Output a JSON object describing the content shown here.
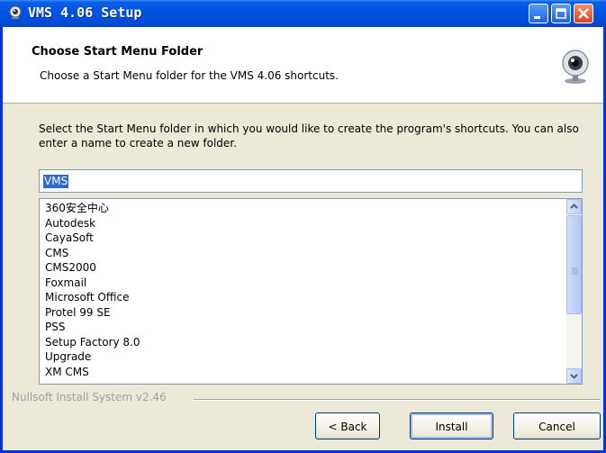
{
  "window": {
    "title": "VMS 4.06 Setup",
    "accent": "#0054e3"
  },
  "header": {
    "title": "Choose Start Menu Folder",
    "subtitle": "Choose a Start Menu folder for the VMS 4.06 shortcuts.",
    "icon": "webcam-icon"
  },
  "body": {
    "instructions": "Select the Start Menu folder in which you would like to create the program's shortcuts. You can also enter a name to create a new folder.",
    "folder_value": "VMS",
    "folders": [
      "360安全中心",
      "Autodesk",
      "CayaSoft",
      "CMS",
      "CMS2000",
      "Foxmail",
      "Microsoft Office",
      "Protel 99 SE",
      "PSS",
      "Setup Factory 8.0",
      "Upgrade",
      "XM CMS"
    ]
  },
  "footer": {
    "branding": "Nullsoft Install System v2.46",
    "back_label": "< Back",
    "install_label": "Install",
    "cancel_label": "Cancel"
  }
}
